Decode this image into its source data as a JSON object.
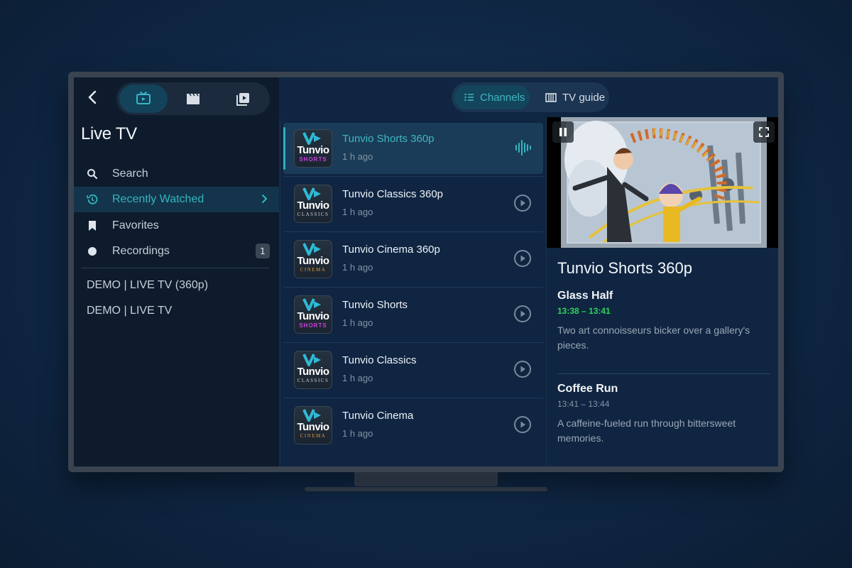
{
  "sidebar": {
    "title": "Live TV",
    "mode_buttons": [
      {
        "icon": "tv-icon",
        "active": true
      },
      {
        "icon": "movie-clapper-icon",
        "active": false
      },
      {
        "icon": "series-library-icon",
        "active": false
      }
    ],
    "items": [
      {
        "label": "Search",
        "icon": "search-icon"
      },
      {
        "label": "Recently Watched",
        "icon": "history-icon",
        "active": true
      },
      {
        "label": "Favorites",
        "icon": "bookmark-icon"
      },
      {
        "label": "Recordings",
        "icon": "record-icon",
        "badge": "1"
      }
    ],
    "groups": [
      "DEMO | LIVE TV (360p)",
      "DEMO | LIVE TV"
    ]
  },
  "tabs": {
    "channels": "Channels",
    "tv_guide": "TV guide"
  },
  "channels": [
    {
      "name": "Tunvio Shorts 360p",
      "time": "1 h ago",
      "logo_word": "Tunvio",
      "logo_sub": "SHORTS",
      "active": true
    },
    {
      "name": "Tunvio Classics 360p",
      "time": "1 h ago",
      "logo_word": "Tunvio",
      "logo_sub": "CLASSICS"
    },
    {
      "name": "Tunvio Cinema 360p",
      "time": "1 h ago",
      "logo_word": "Tunvio",
      "logo_sub": "CINEMA"
    },
    {
      "name": "Tunvio Shorts",
      "time": "1 h ago",
      "logo_word": "Tunvio",
      "logo_sub": "SHORTS"
    },
    {
      "name": "Tunvio Classics",
      "time": "1 h ago",
      "logo_word": "Tunvio",
      "logo_sub": "CLASSICS"
    },
    {
      "name": "Tunvio Cinema",
      "time": "1 h ago",
      "logo_word": "Tunvio",
      "logo_sub": "CINEMA"
    }
  ],
  "detail": {
    "channel_title": "Tunvio Shorts 360p",
    "programs": [
      {
        "title": "Glass Half",
        "time": "13:38 – 13:41",
        "description": "Two art connoisseurs bicker over a gallery's pieces.",
        "live": true
      },
      {
        "title": "Coffee Run",
        "time": "13:41 – 13:44",
        "description": "A caffeine-fueled run through bittersweet memories.",
        "live": false
      }
    ]
  },
  "colors": {
    "accent": "#34b4c0",
    "live_time": "#2ed35a",
    "shorts_magenta": "#c93fe0",
    "cinema_orange": "#d89b3c"
  }
}
